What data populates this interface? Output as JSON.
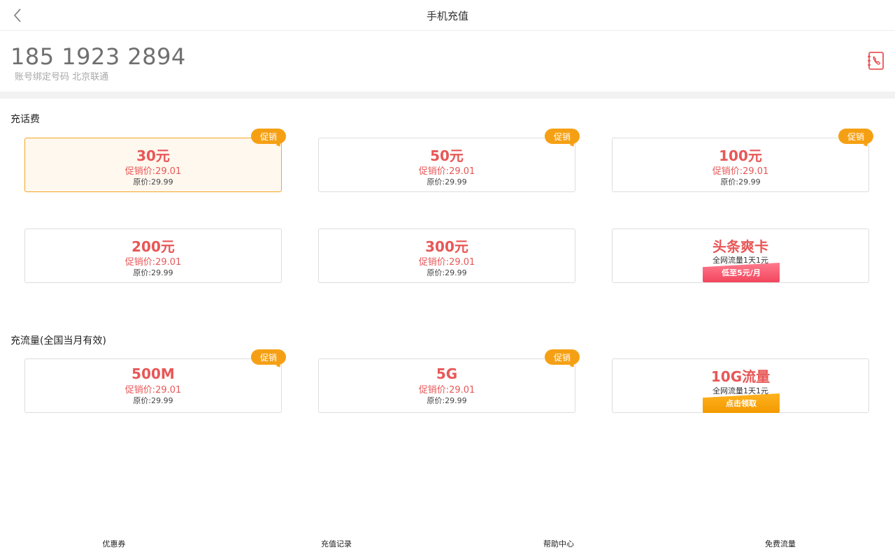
{
  "header": {
    "title": "手机充值"
  },
  "account": {
    "phone_number": "185 1923 2894",
    "subtitle": "账号绑定号码 北京联通"
  },
  "sections": {
    "call_fee_title": "充话费",
    "data_title": "充流量(全国当月有效)"
  },
  "promo_badge_label": "促销",
  "call_fee_cards": [
    {
      "amount": "30元",
      "promo_price": "促销价:29.01",
      "orig_price": "原价:29.99",
      "promo": true,
      "selected": true
    },
    {
      "amount": "50元",
      "promo_price": "促销价:29.01",
      "orig_price": "原价:29.99",
      "promo": true
    },
    {
      "amount": "100元",
      "promo_price": "促销价:29.01",
      "orig_price": "原价:29.99",
      "promo": true
    },
    {
      "amount": "200元",
      "promo_price": "促销价:29.01",
      "orig_price": "原价:29.99"
    },
    {
      "amount": "300元",
      "promo_price": "促销价:29.01",
      "orig_price": "原价:29.99"
    },
    {
      "amount": "头条爽卡",
      "desc": "全网流量1天1元",
      "ribbon": "低至5元/月"
    }
  ],
  "data_cards": [
    {
      "amount": "500M",
      "promo_price": "促销价:29.01",
      "orig_price": "原价:29.99",
      "promo": true
    },
    {
      "amount": "5G",
      "promo_price": "促销价:29.01",
      "orig_price": "原价:29.99",
      "promo": true
    },
    {
      "amount": "10G流量",
      "desc": "全网流量1天1元",
      "ribbon": "点击领取"
    }
  ],
  "bottom_nav": [
    "优惠券",
    "充值记录",
    "帮助中心",
    "免费流量"
  ],
  "colors": {
    "accent_red": "#e85757",
    "promo_orange": "#f5a014",
    "selected_border": "#f5a623"
  }
}
